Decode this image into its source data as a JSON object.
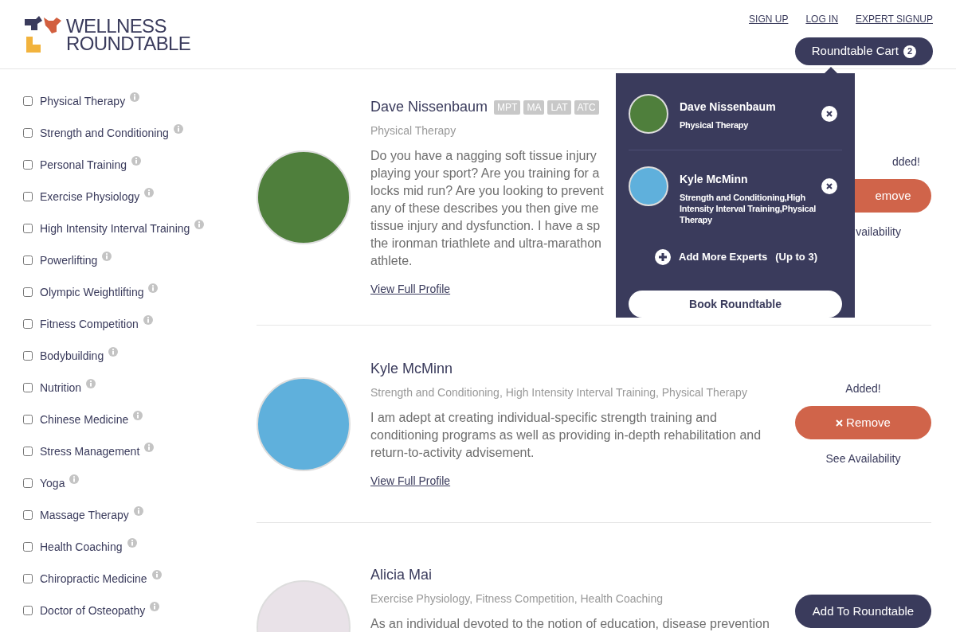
{
  "header": {
    "logo": [
      "WELLNESS",
      "ROUNDTABLE"
    ],
    "links": [
      "SIGN UP",
      "LOG IN",
      "EXPERT SIGNUP"
    ],
    "cart": {
      "label": "Roundtable Cart",
      "count": "2"
    }
  },
  "filters": [
    {
      "label": "Physical Therapy",
      "checked": false
    },
    {
      "label": "Strength and Conditioning",
      "checked": false
    },
    {
      "label": "Personal Training",
      "checked": false
    },
    {
      "label": "Exercise Physiology",
      "checked": false
    },
    {
      "label": "High Intensity Interval Training",
      "checked": false
    },
    {
      "label": "Powerlifting",
      "checked": false
    },
    {
      "label": "Olympic Weightlifting",
      "checked": false
    },
    {
      "label": "Fitness Competition",
      "checked": false
    },
    {
      "label": "Bodybuilding",
      "checked": false
    },
    {
      "label": "Nutrition",
      "checked": false
    },
    {
      "label": "Chinese Medicine",
      "checked": false
    },
    {
      "label": "Stress Management",
      "checked": false
    },
    {
      "label": "Yoga",
      "checked": false
    },
    {
      "label": "Massage Therapy",
      "checked": false
    },
    {
      "label": "Health Coaching",
      "checked": false
    },
    {
      "label": "Chiropractic Medicine",
      "checked": false
    },
    {
      "label": "Doctor of Osteopathy",
      "checked": false
    }
  ],
  "experts": [
    {
      "name": "Dave Nissenbaum",
      "badges": [
        "MPT",
        "MA",
        "LAT",
        "ATC"
      ],
      "specialties": "Physical Therapy",
      "description_lines": [
        "Do you have a nagging soft tissue injury",
        "playing your sport? Are you training for a",
        "locks mid run? Are you looking to prevent",
        "any of these describes you then give me",
        "tissue injury and dysfunction. I have a sp",
        "the ironman triathlete and ultra-marathon",
        "athlete."
      ],
      "link": "View Full Profile",
      "status": "dded!",
      "action": {
        "kind": "remove_partial",
        "label": "emove"
      },
      "availability": "vailability"
    },
    {
      "name": "Kyle McMinn",
      "specialties": "Strength and Conditioning, High Intensity Interval Training, Physical Therapy",
      "description_lines": [
        "I am adept at creating individual-specific strength training and",
        "conditioning programs as well as providing in-depth rehabilitation and",
        "return-to-activity advisement."
      ],
      "link": "View Full Profile",
      "status": "Added!",
      "action": {
        "kind": "remove",
        "label": "Remove"
      },
      "availability": "See Availability"
    },
    {
      "name": "Alicia Mai",
      "specialties": "Exercise Physiology, Fitness Competition, Health Coaching",
      "description_lines": [
        "As an individual devoted to the notion of education, disease prevention"
      ],
      "action": {
        "kind": "add",
        "label": "Add To Roundtable"
      }
    }
  ],
  "cart_popover": {
    "items": [
      {
        "name": "Dave Nissenbaum",
        "specialties": "Physical Therapy"
      },
      {
        "name": "Kyle McMinn",
        "specialties": "Strength and Conditioning,High Intensity Interval Training,Physical Therapy"
      }
    ],
    "add_more": "Add More Experts",
    "add_more_note": "(Up to 3)",
    "book": "Book Roundtable"
  }
}
